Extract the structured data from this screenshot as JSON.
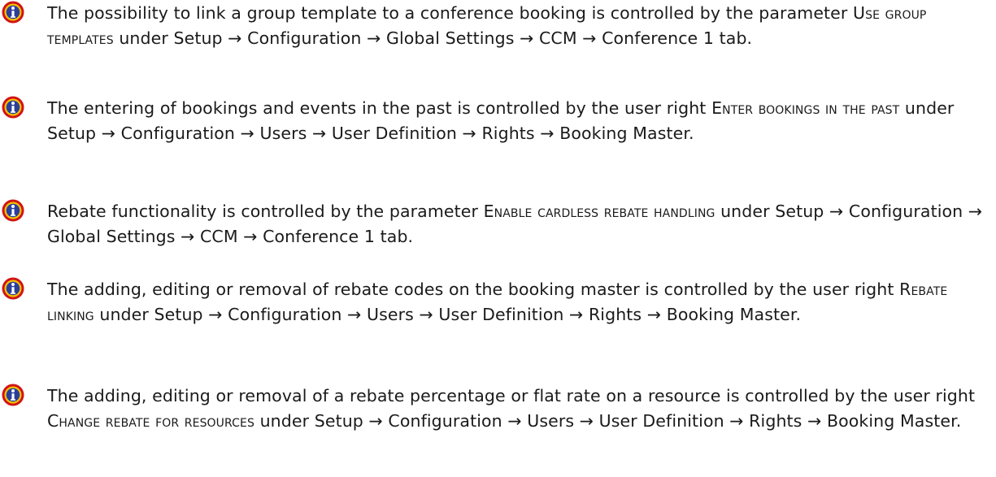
{
  "icon": "info-icon",
  "colors": {
    "icon_outer": "#d11414",
    "icon_ring": "#f2c200",
    "icon_inner": "#2a3f9c"
  },
  "notes": [
    {
      "pre": "The possibility to link a group template to a conference booking is controlled by the parameter ",
      "term": "Use group templates",
      "post": " under Setup → Configuration → Global Settings → CCM → Conference 1 tab."
    },
    {
      "pre": "The entering of bookings and events in the past is controlled by the user right ",
      "term": "Enter bookings in the past",
      "post": " under Setup → Configuration → Users → User Definition → Rights → Booking Master."
    },
    {
      "pre": "Rebate functionality is controlled by the parameter ",
      "term": "Enable cardless rebate handling",
      "post": " under Setup → Configuration → Global Settings → CCM → Conference 1 tab."
    },
    {
      "pre": "The adding, editing or removal of rebate codes on the booking master is controlled by the user right ",
      "term": "Rebate linking",
      "post": " under Setup → Configuration → Users → User Definition → Rights → Booking Master."
    },
    {
      "pre": "The adding, editing or removal of a rebate percentage or flat rate on a resource is controlled by the user right ",
      "term": "Change rebate for resources",
      "post": " under Setup → Configuration → Users → User Definition → Rights → Booking Master."
    }
  ]
}
